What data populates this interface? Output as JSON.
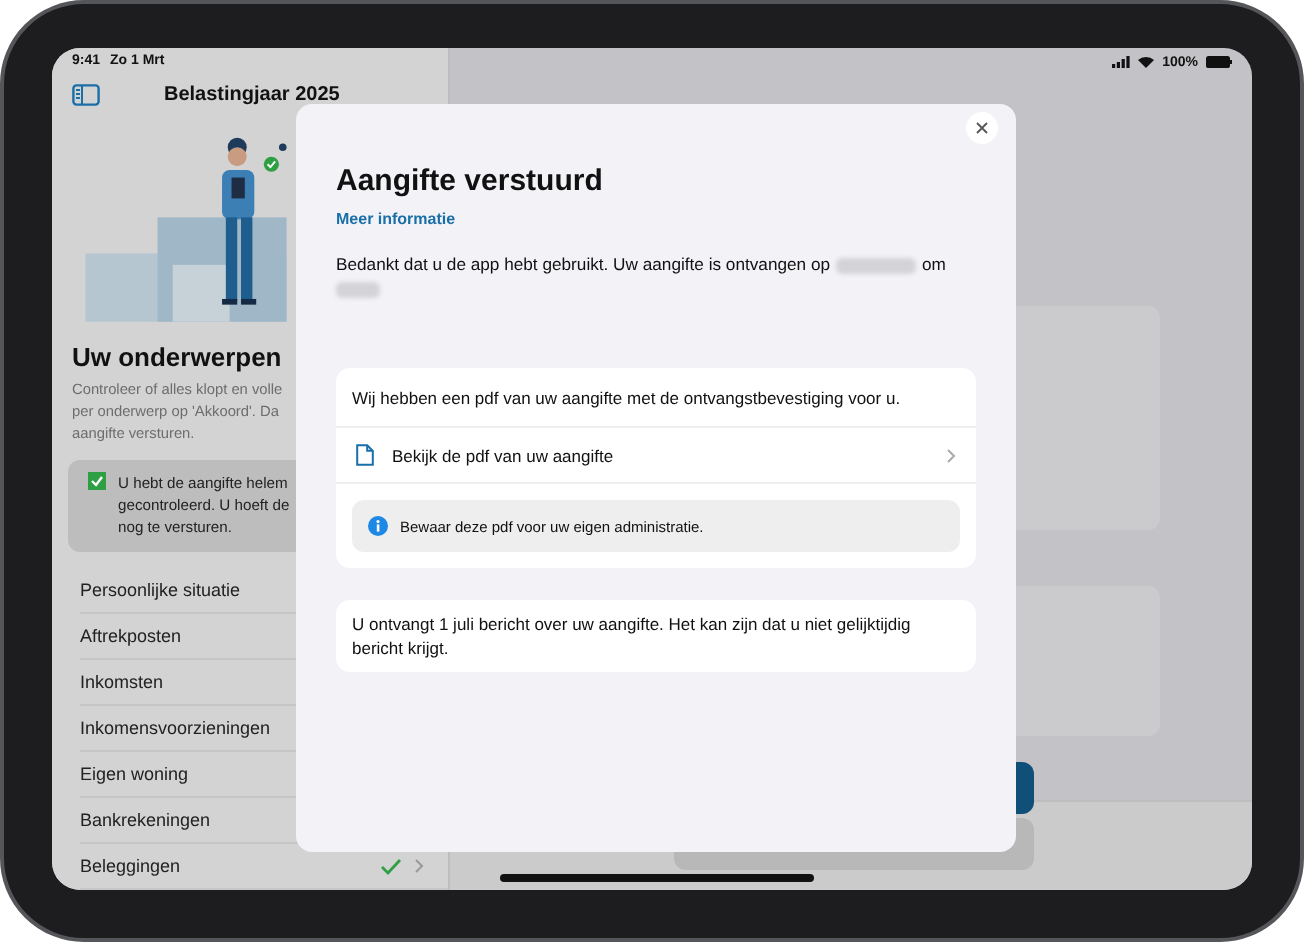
{
  "status_bar": {
    "time": "9:41",
    "date": "Zo 1 Mrt",
    "battery": "100%"
  },
  "sidebar": {
    "title": "Belastingjaar 2025",
    "section_title": "Uw onderwerpen",
    "description_lines": [
      "Controleer of alles klopt en volle",
      "per onderwerp op 'Akkoord'. Da",
      "aangifte versturen."
    ],
    "notice": {
      "checked": true,
      "lines": [
        "U hebt de aangifte helem",
        "gecontroleerd. U hoeft de",
        "nog te versturen."
      ]
    },
    "items": [
      {
        "label": "Persoonlijke situatie"
      },
      {
        "label": "Aftrekposten"
      },
      {
        "label": "Inkomsten"
      },
      {
        "label": "Inkomensvoorzieningen"
      },
      {
        "label": "Eigen woning"
      },
      {
        "label": "Bankrekeningen"
      },
      {
        "label": "Beleggingen",
        "checked": true
      }
    ]
  },
  "dialog": {
    "title": "Aangifte verstuurd",
    "link": "Meer informatie",
    "message_start": "Bedankt dat u de app hebt gebruikt. Uw aangifte is ontvangen op",
    "message_mid": "om",
    "pdf_card": {
      "intro": "Wij hebben een pdf van uw aangifte met de ontvangstbevestiging voor u.",
      "action": "Bekijk de pdf van uw aangifte",
      "info": "Bewaar deze pdf voor uw eigen administratie."
    },
    "note": "U ontvangt 1 juli bericht over uw aangifte. Het kan zijn dat u niet gelijktijdig bericht krijgt."
  }
}
